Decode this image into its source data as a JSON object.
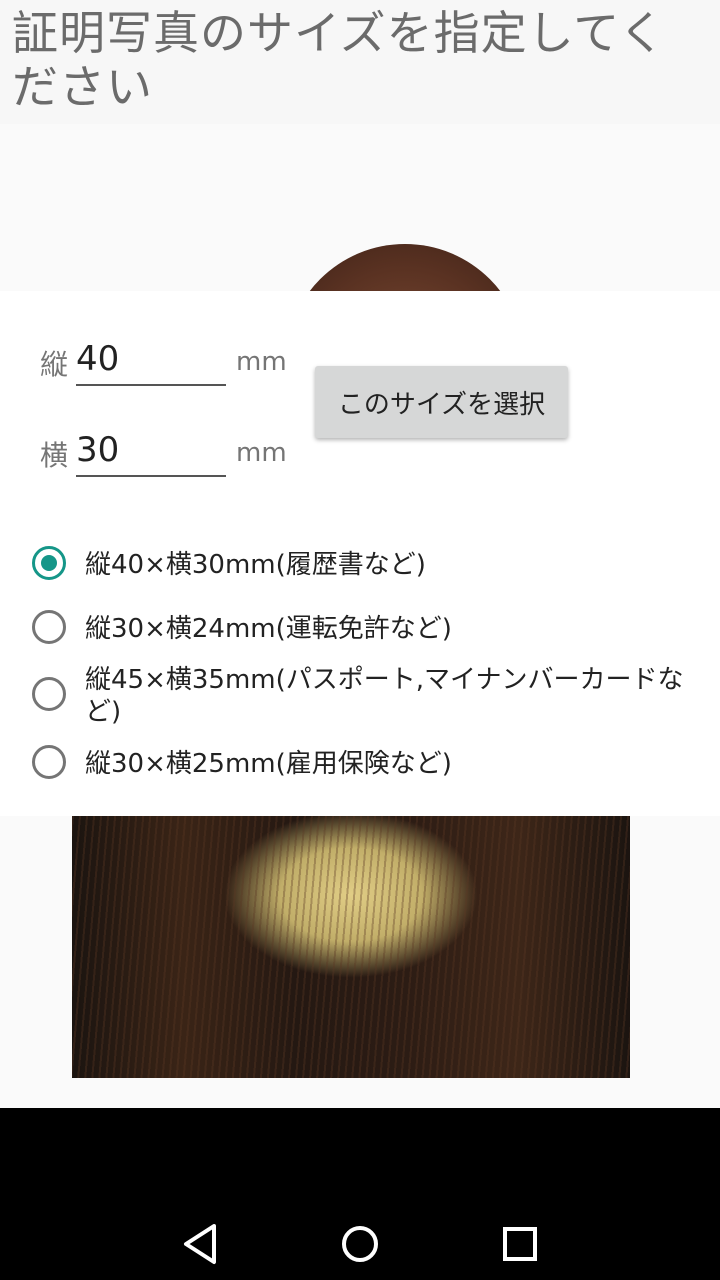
{
  "title": "証明写真のサイズを指定してください",
  "form": {
    "height_label": "縦",
    "height_value": "40",
    "height_unit": "mm",
    "width_label": "横",
    "width_value": "30",
    "width_unit": "mm",
    "select_button_label": "このサイズを選択"
  },
  "size_options": [
    {
      "label": "縦40×横30mm(履歴書など)",
      "checked": true
    },
    {
      "label": "縦30×横24mm(運転免許など)",
      "checked": false
    },
    {
      "label": "縦45×横35mm(パスポート,マイナンバーカードなど)",
      "checked": false
    },
    {
      "label": "縦30×横25mm(雇用保険など)",
      "checked": false
    }
  ],
  "colors": {
    "accent": "#159688",
    "button_bg": "#d6d7d7",
    "title_text": "#6b6b6b"
  },
  "navbar": {
    "icons": [
      "back-triangle-icon",
      "home-circle-icon",
      "recents-square-icon"
    ]
  }
}
